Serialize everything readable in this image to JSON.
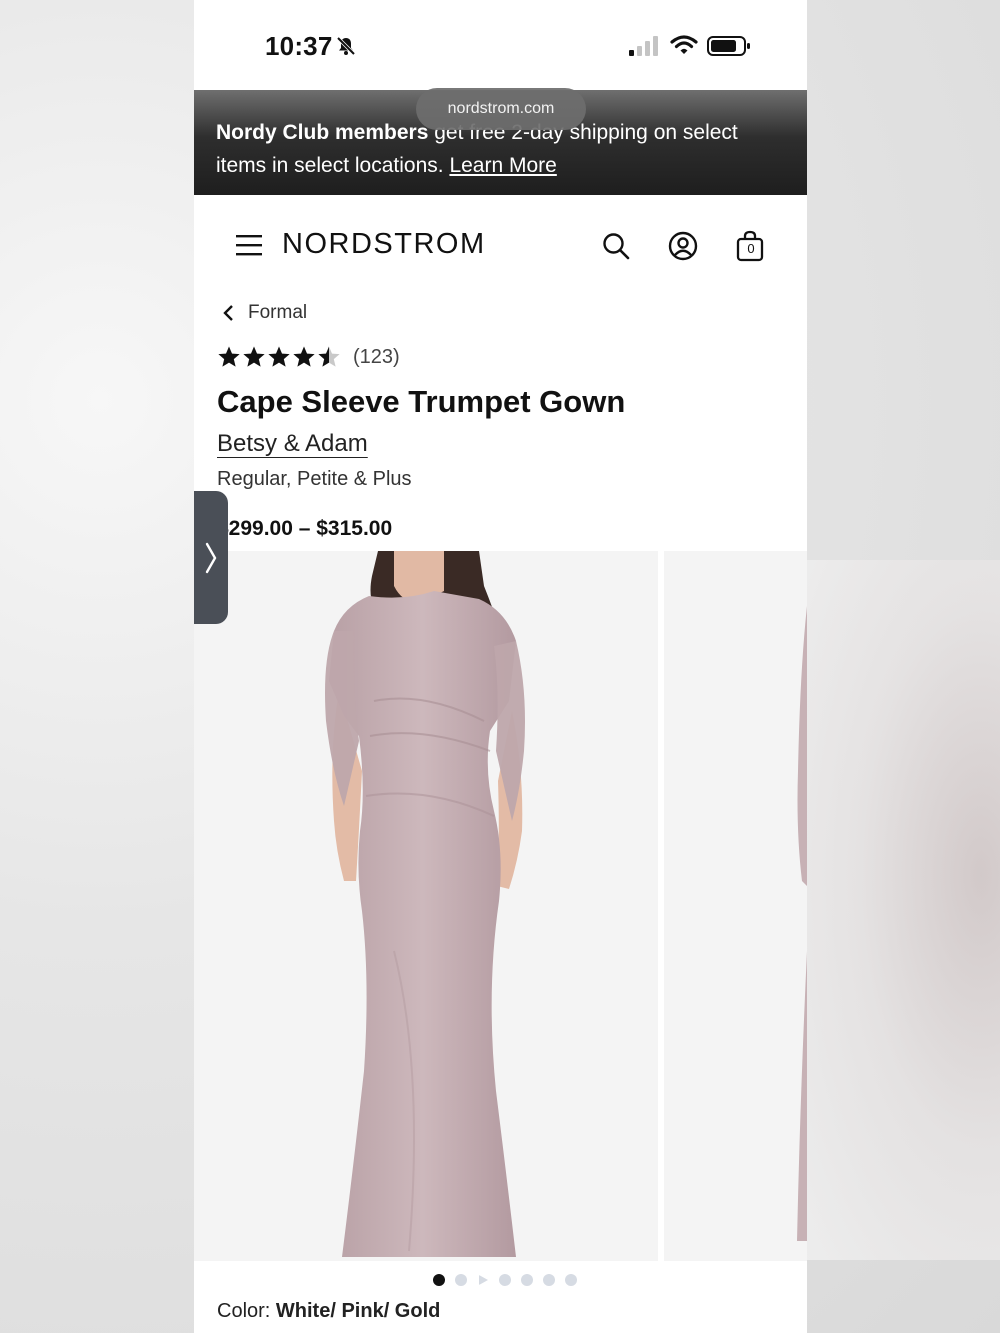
{
  "status_bar": {
    "time": "10:37",
    "icons": [
      "bell-slash-icon",
      "cellular-signal-icon",
      "wifi-icon",
      "battery-icon"
    ]
  },
  "browser": {
    "url": "nordstrom.com"
  },
  "promo": {
    "bold_text": "Nordy Club members",
    "text": " get free 2-day shipping on select items in select locations. ",
    "link": "Learn More"
  },
  "header": {
    "logo": "NORDSTROM",
    "icons": [
      "menu-icon",
      "search-icon",
      "account-icon",
      "shopping-bag-icon"
    ],
    "bag_count": "0"
  },
  "breadcrumb": {
    "label": "Formal"
  },
  "product": {
    "rating_value": 4.5,
    "review_count": "(123)",
    "title": "Cape Sleeve Trumpet Gown",
    "brand": "Betsy & Adam",
    "sizes": "Regular, Petite & Plus",
    "price": "$299.00 – $315.00",
    "color_label": "Color: ",
    "color_value": "White/ Pink/ Gold"
  },
  "gallery": {
    "image_count": 7,
    "active_index": 0,
    "has_video": true
  },
  "colors": {
    "promo_bg": "#1e1e1e",
    "side_tab": "#4a4f57",
    "dot_inactive": "#d6dbe3",
    "dress": "#c5aeb2"
  }
}
